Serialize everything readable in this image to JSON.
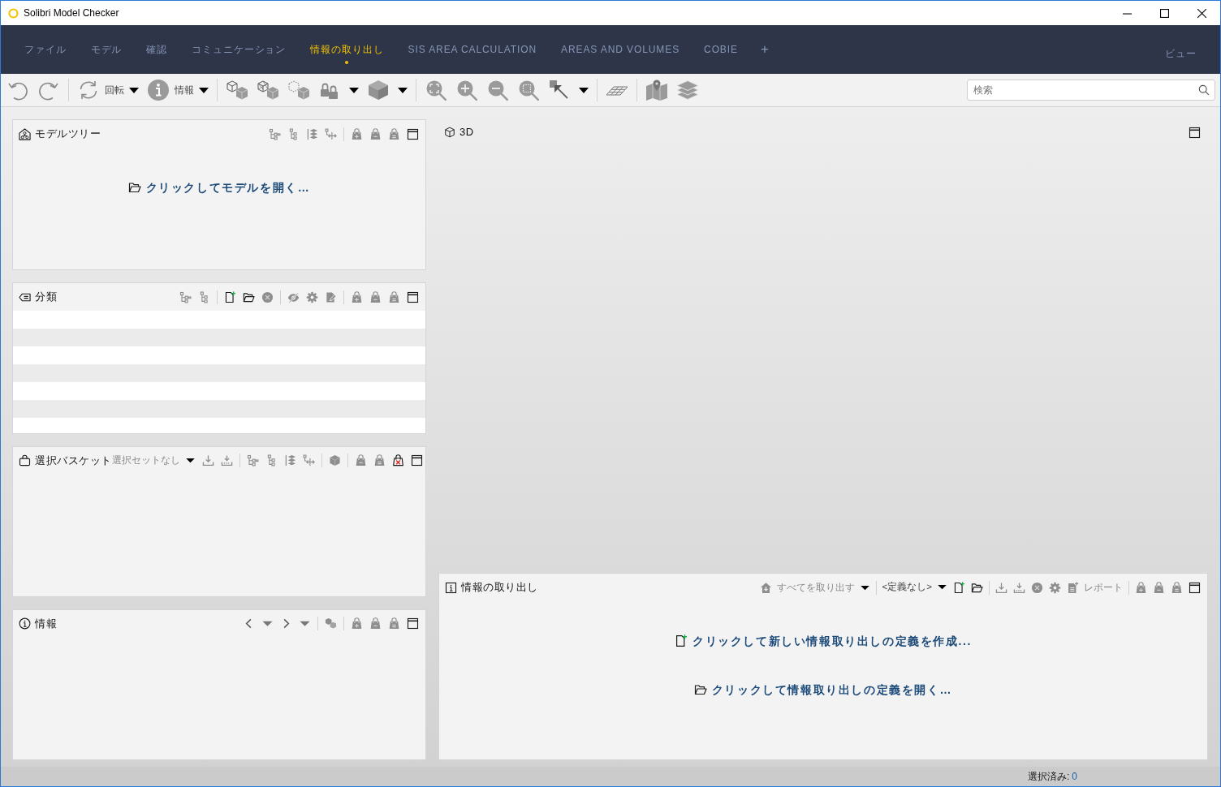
{
  "window": {
    "title": "Solibri Model Checker"
  },
  "ribbon": {
    "tabs": [
      {
        "label": "ファイル",
        "selected": false
      },
      {
        "label": "モデル",
        "selected": false
      },
      {
        "label": "確認",
        "selected": false
      },
      {
        "label": "コミュニケーション",
        "selected": false
      },
      {
        "label": "情報の取り出し",
        "selected": true
      },
      {
        "label": "SIS AREA CALCULATION",
        "selected": false
      },
      {
        "label": "AREAS AND VOLUMES",
        "selected": false
      },
      {
        "label": "COBIE",
        "selected": false
      }
    ],
    "add_tab": "+",
    "view_menu": "ビュー"
  },
  "toolbar": {
    "dropdowns": [
      {
        "label": "回転"
      },
      {
        "label": "情報"
      }
    ],
    "search": {
      "placeholder": "検索"
    }
  },
  "left_panels": [
    {
      "kind": "model_tree",
      "title": "モデルツリー",
      "link": "クリックしてモデルを開く…"
    },
    {
      "kind": "classification",
      "title": "分類"
    },
    {
      "kind": "selection_basket",
      "title": "選択バスケット",
      "selection_set": "選択セットなし"
    },
    {
      "kind": "info",
      "title": "情報"
    }
  ],
  "view_3d": {
    "title": "3D"
  },
  "extraction": {
    "title": "情報の取り出し",
    "extract_all": {
      "label": "すべてを取り出す",
      "disabled": true
    },
    "definition": "<定義なし>",
    "report": {
      "label": "レポート",
      "disabled": true
    },
    "links": [
      {
        "kind": "new",
        "text": "クリックして新しい情報取り出しの定義を作成..."
      },
      {
        "kind": "open",
        "text": "クリックして情報取り出しの定義を開く…"
      }
    ]
  },
  "status_bar": {
    "label": "選択済み:",
    "value": "0"
  }
}
